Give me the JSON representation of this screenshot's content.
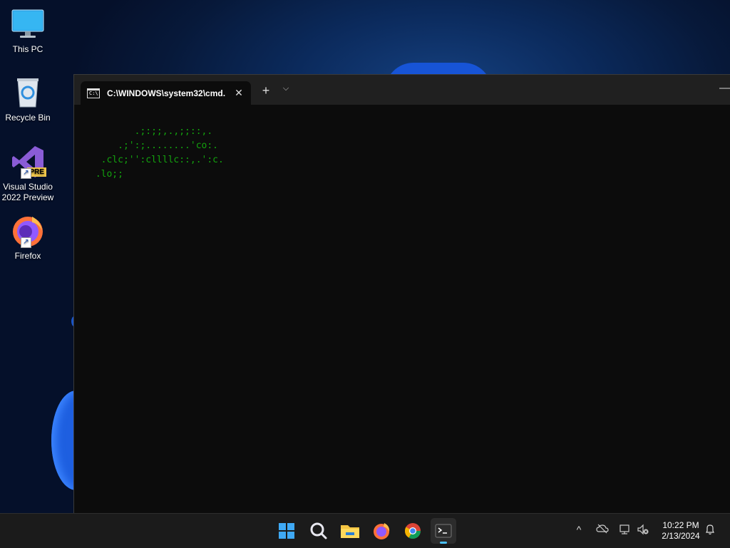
{
  "desktop": {
    "icons": [
      {
        "label": "This PC"
      },
      {
        "label": "Recycle Bin"
      },
      {
        "label_line1": "Visual Studio",
        "label_line2": "2022 Preview",
        "badge": "PRE"
      },
      {
        "label": "Firefox"
      }
    ]
  },
  "terminal": {
    "tab_title": "C:\\WINDOWS\\system32\\cmd.",
    "tab_icon_text": "C:\\",
    "close_glyph": "✕",
    "add_glyph": "+",
    "dropdown_glyph": "⌵",
    "minimize_glyph": "—",
    "text_color": "#13a10e",
    "output_lines": [
      "        .;:;;,.,;;::,.",
      "     .;':;........'co:.",
      "  .clc;'':cllllc::,.':c.",
      " .lo;;"
    ]
  },
  "taskbar": {
    "apps": [
      {
        "icon": "windows-start-icon"
      },
      {
        "icon": "search-icon"
      },
      {
        "icon": "file-explorer-icon"
      },
      {
        "icon": "firefox-icon"
      },
      {
        "icon": "chrome-icon"
      },
      {
        "icon": "terminal-icon",
        "active": true
      }
    ],
    "tray": {
      "chevron": "^",
      "time": "10:22 PM",
      "date": "2/13/2024"
    },
    "accent_color": "#4cc2ff"
  }
}
